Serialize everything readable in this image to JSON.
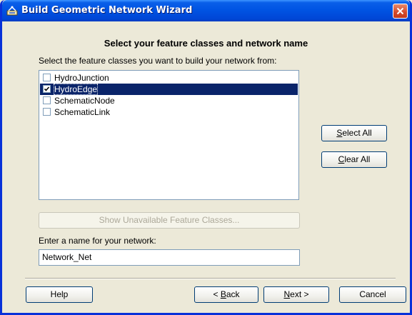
{
  "window": {
    "title": "Build Geometric Network Wizard"
  },
  "page": {
    "heading": "Select your feature classes and network name",
    "instructions": "Select the feature classes you want to build your network from:",
    "feature_classes": [
      {
        "label": "HydroJunction",
        "checked": false,
        "selected": false
      },
      {
        "label": "HydroEdge",
        "checked": true,
        "selected": true
      },
      {
        "label": "SchematicNode",
        "checked": false,
        "selected": false
      },
      {
        "label": "SchematicLink",
        "checked": false,
        "selected": false
      }
    ],
    "select_all_prefix": "S",
    "select_all_rest": "elect All",
    "clear_all_prefix": "C",
    "clear_all_rest": "lear All",
    "show_unavailable_label": "Show Unavailable Feature Classes...",
    "name_label": "Enter a name for your network:",
    "network_name_value": "Network_Net"
  },
  "footer": {
    "help_label": "Help",
    "back_pre": "< ",
    "back_hot": "B",
    "back_rest": "ack",
    "next_hot": "N",
    "next_rest": "ext >",
    "cancel_label": "Cancel"
  },
  "colors": {
    "titlebar": "#0054e3",
    "selection": "#0a246a",
    "dialog_bg": "#ece9d8"
  }
}
